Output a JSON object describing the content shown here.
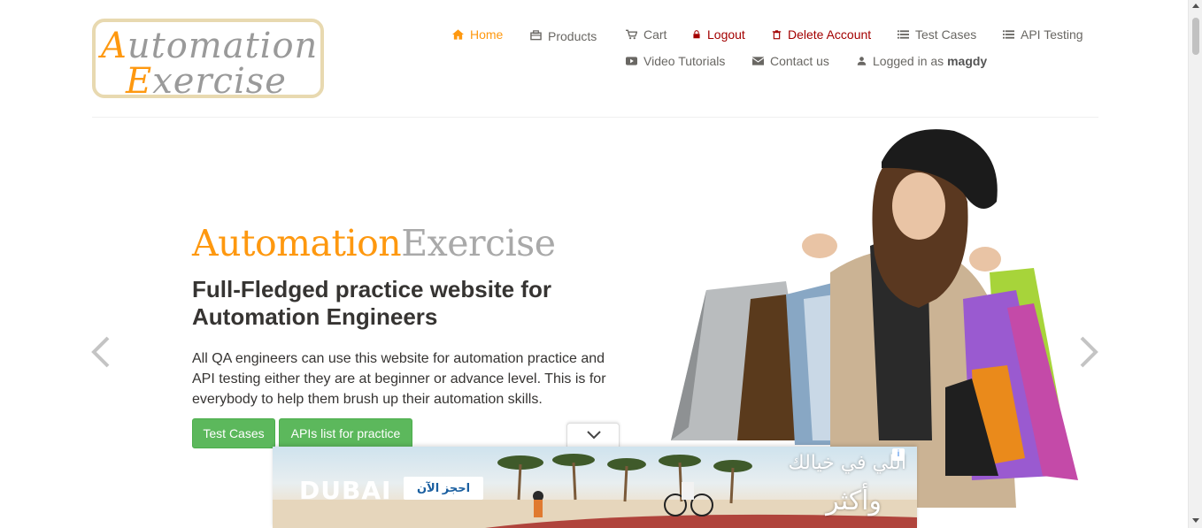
{
  "logo": {
    "line1_cap": "A",
    "line1_rest": "utomation",
    "line2_cap": "E",
    "line2_rest": "xercise"
  },
  "nav": {
    "row1": [
      {
        "label": "Home",
        "icon": "home-icon"
      },
      {
        "label": "Products",
        "icon": "products-icon"
      },
      {
        "label": "Cart",
        "icon": "cart-icon"
      },
      {
        "label": "Logout",
        "icon": "lock-icon"
      },
      {
        "label": "Delete Account",
        "icon": "trash-icon"
      },
      {
        "label": "Test Cases",
        "icon": "list-icon"
      },
      {
        "label": "API Testing",
        "icon": "list-icon"
      }
    ],
    "row2": [
      {
        "label": "Video Tutorials",
        "icon": "youtube-icon"
      },
      {
        "label": "Contact us",
        "icon": "envelope-icon"
      },
      {
        "label": "Logged in as",
        "icon": "user-icon",
        "user": "magdy"
      }
    ]
  },
  "slide": {
    "brand_a": "Automation",
    "brand_b": "Exercise",
    "headline": "Full-Fledged practice website for Automation Engineers",
    "description": "All QA engineers can use this website for automation practice and API testing either they are at beginner or advance level. This is for everybody to help them brush up their automation skills.",
    "btn_test_cases": "Test Cases",
    "btn_apis": "APIs list for practice"
  },
  "ad": {
    "brand": "DUBAI",
    "cta": "احجز الآن",
    "headline": "اللي في خيالك",
    "tagline": "وأكثر",
    "info": "i"
  },
  "colors": {
    "accent": "#fe980f",
    "green": "#5cb85c",
    "red": "#a30000"
  }
}
